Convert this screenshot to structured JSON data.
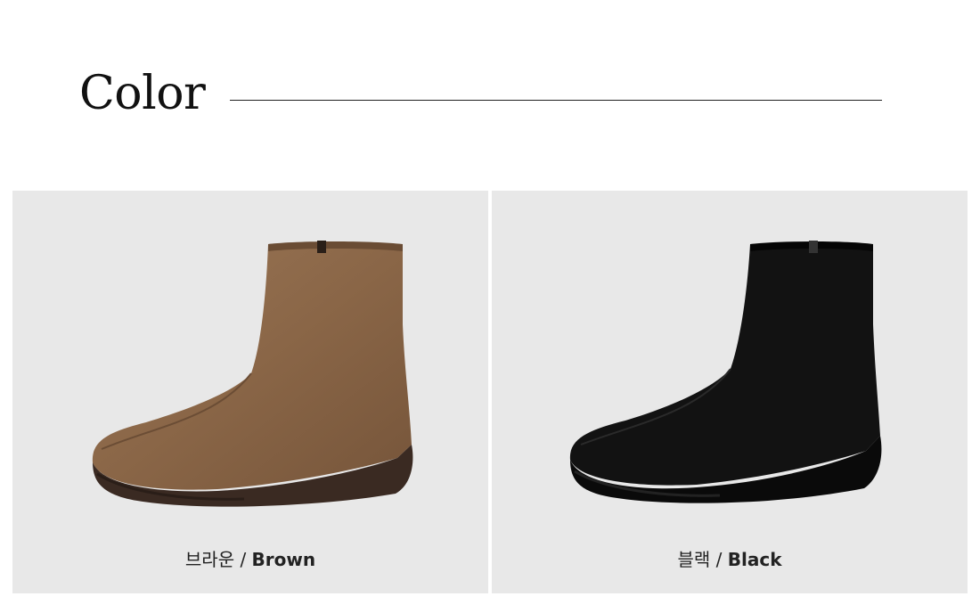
{
  "section": {
    "title": "Color"
  },
  "colors": [
    {
      "name_ko": "브라운",
      "separator": " / ",
      "name_en": "Brown",
      "swatch": "#8a6647",
      "sole": "#3a2a22"
    },
    {
      "name_ko": "블랙",
      "separator": " / ",
      "name_en": "Black",
      "swatch": "#0d0d0d",
      "sole": "#111111"
    }
  ],
  "background": "#e8e8e8"
}
